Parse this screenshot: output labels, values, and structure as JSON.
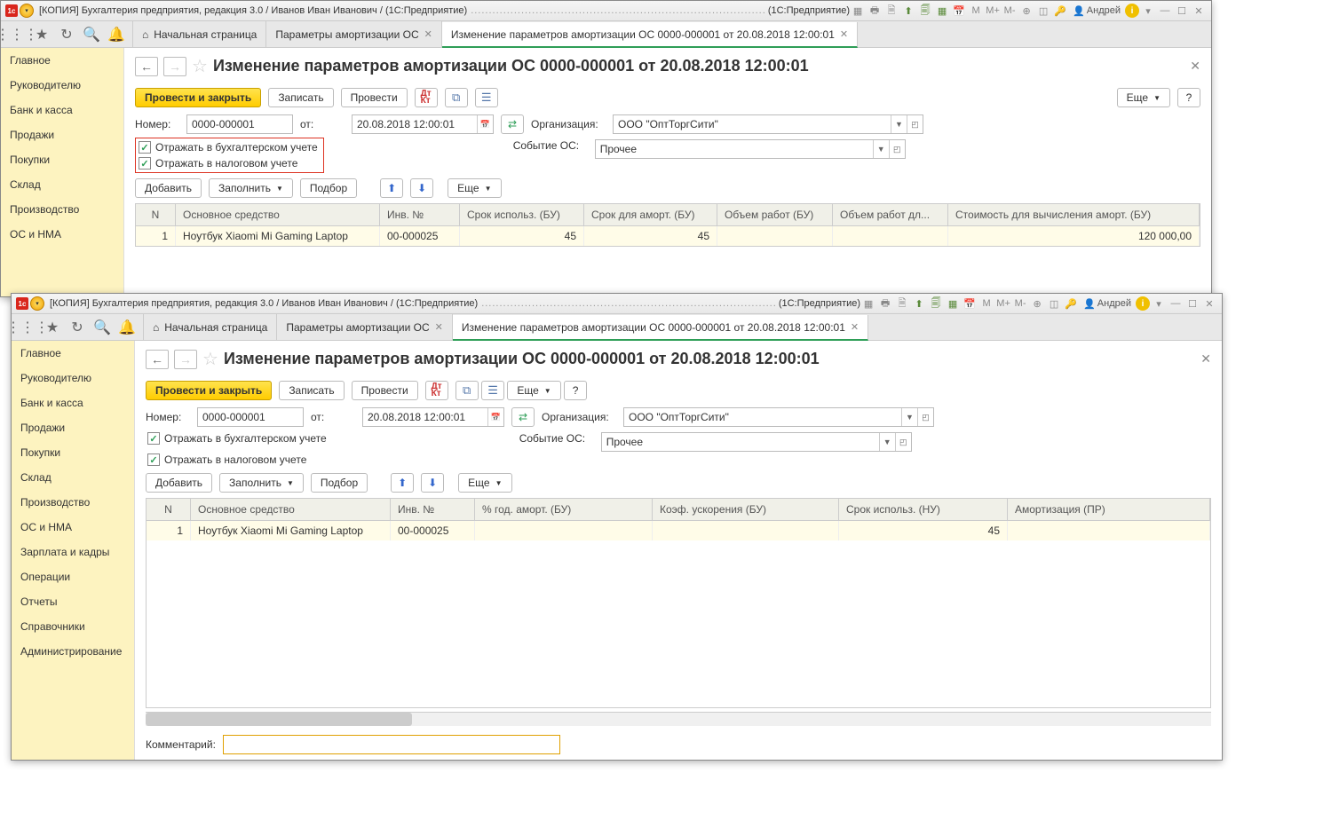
{
  "window1": {
    "title": "[КОПИЯ] Бухгалтерия предприятия, редакция 3.0 / Иванов Иван Иванович / (1С:Предприятие)",
    "mode": "(1С:Предприятие)",
    "user": "Андрей",
    "tabs": {
      "home": "Начальная страница",
      "t1": "Параметры амортизации ОС",
      "t2": "Изменение параметров амортизации ОС 0000-000001 от 20.08.2018 12:00:01"
    },
    "sidebar": [
      "Главное",
      "Руководителю",
      "Банк и касса",
      "Продажи",
      "Покупки",
      "Склад",
      "Производство",
      "ОС и НМА"
    ],
    "page": {
      "title": "Изменение параметров амортизации ОС 0000-000001 от 20.08.2018 12:00:01",
      "btn_primary": "Провести и закрыть",
      "btn_write": "Записать",
      "btn_post": "Провести",
      "btn_more": "Еще",
      "lbl_number": "Номер:",
      "val_number": "0000-000001",
      "lbl_from": "от:",
      "val_date": "20.08.2018 12:00:01",
      "lbl_org": "Организация:",
      "val_org": "ООО \"ОптТоргСити\"",
      "lbl_event": "Событие ОС:",
      "val_event": "Прочее",
      "chk1": "Отражать в бухгалтерском учете",
      "chk2": "Отражать в налоговом учете",
      "btn_add": "Добавить",
      "btn_fill": "Заполнить",
      "btn_pick": "Подбор",
      "cols": [
        "N",
        "Основное средство",
        "Инв. №",
        "Срок использ. (БУ)",
        "Срок для аморт. (БУ)",
        "Объем работ (БУ)",
        "Объем работ дл...",
        "Стоимость для вычисления аморт. (БУ)"
      ],
      "row": {
        "n": "1",
        "asset": "Ноутбук Xiaomi Mi Gaming Laptop",
        "inv": "00-000025",
        "c1": "45",
        "c2": "45",
        "c3": "",
        "c4": "",
        "cost": "120 000,00"
      }
    }
  },
  "window2": {
    "title": "[КОПИЯ] Бухгалтерия предприятия, редакция 3.0 / Иванов Иван Иванович / (1С:Предприятие)",
    "mode": "(1С:Предприятие)",
    "user": "Андрей",
    "tabs": {
      "home": "Начальная страница",
      "t1": "Параметры амортизации ОС",
      "t2": "Изменение параметров амортизации ОС 0000-000001 от 20.08.2018 12:00:01"
    },
    "sidebar": [
      "Главное",
      "Руководителю",
      "Банк и касса",
      "Продажи",
      "Покупки",
      "Склад",
      "Производство",
      "ОС и НМА",
      "Зарплата и кадры",
      "Операции",
      "Отчеты",
      "Справочники",
      "Администрирование"
    ],
    "page": {
      "title": "Изменение параметров амортизации ОС 0000-000001 от 20.08.2018 12:00:01",
      "btn_primary": "Провести и закрыть",
      "btn_write": "Записать",
      "btn_post": "Провести",
      "btn_more": "Еще",
      "lbl_number": "Номер:",
      "val_number": "0000-000001",
      "lbl_from": "от:",
      "val_date": "20.08.2018 12:00:01",
      "lbl_org": "Организация:",
      "val_org": "ООО \"ОптТоргСити\"",
      "lbl_event": "Событие ОС:",
      "val_event": "Прочее",
      "chk1": "Отражать в бухгалтерском учете",
      "chk2": "Отражать в налоговом учете",
      "btn_add": "Добавить",
      "btn_fill": "Заполнить",
      "btn_pick": "Подбор",
      "cols": [
        "N",
        "Основное средство",
        "Инв. №",
        "% год. аморт. (БУ)",
        "Коэф. ускорения (БУ)",
        "Срок использ. (НУ)",
        "Амортизация (ПР)"
      ],
      "row": {
        "n": "1",
        "asset": "Ноутбук Xiaomi Mi Gaming Laptop",
        "inv": "00-000025",
        "c1": "",
        "c2": "",
        "c3": "45",
        "c4": ""
      },
      "lbl_comment": "Комментарий:"
    }
  }
}
